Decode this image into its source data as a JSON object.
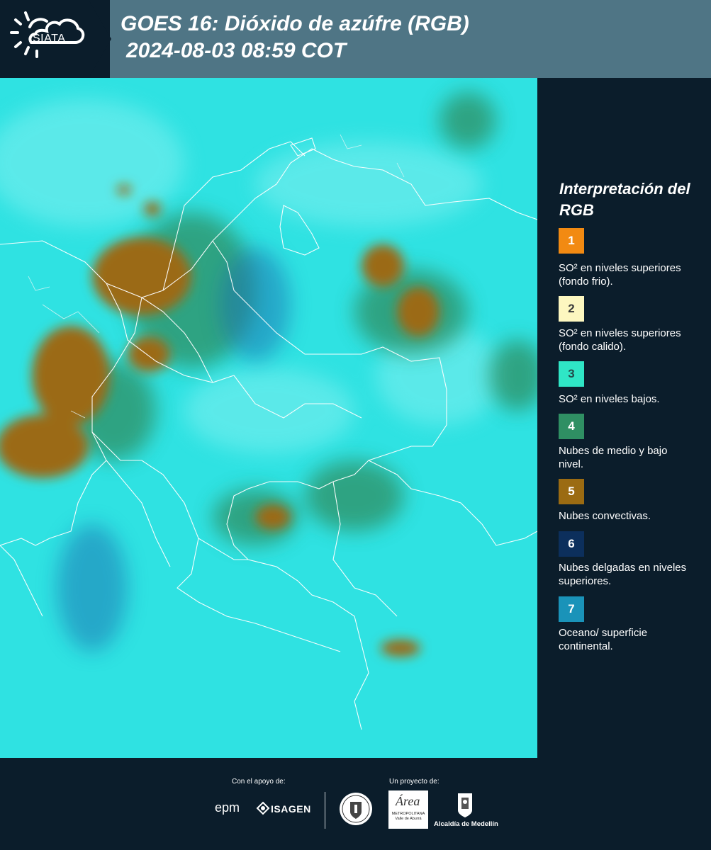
{
  "header": {
    "logo_text": "SIATA",
    "title_line1": "GOES 16: Dióxido de azúfre (RGB)",
    "title_line2": "2024-08-03 08:59 COT"
  },
  "legend": {
    "title": "Interpretación del RGB",
    "items": [
      {
        "number": "1",
        "color": "#f28a12",
        "text_color": "#ffffff",
        "label": "SO² en niveles superiores (fondo frio)."
      },
      {
        "number": "2",
        "color": "#fdf7c0",
        "text_color": "#3a3a3a",
        "label": "SO² en niveles superiores (fondo calido)."
      },
      {
        "number": "3",
        "color": "#2fe6c6",
        "text_color": "#234a4a",
        "label": "SO² en niveles bajos."
      },
      {
        "number": "4",
        "color": "#2f8f63",
        "text_color": "#ffffff",
        "label": "Nubes de medio y bajo nivel."
      },
      {
        "number": "5",
        "color": "#9b6b12",
        "text_color": "#ffffff",
        "label": "Nubes convectivas."
      },
      {
        "number": "6",
        "color": "#0c2f5c",
        "text_color": "#ffffff",
        "label": "Nubes delgadas en niveles superiores."
      },
      {
        "number": "7",
        "color": "#1a93b9",
        "text_color": "#ffffff",
        "label": "Oceano/ superficie continental."
      }
    ]
  },
  "footer": {
    "support_caption": "Con el apoyo de:",
    "project_caption": "Un proyecto de:",
    "epm": "epm",
    "isagen": "ISAGEN",
    "area_label": "METROPOLITANA Valle de Aburrá",
    "alcaldia": "Alcaldía de Medellín"
  }
}
